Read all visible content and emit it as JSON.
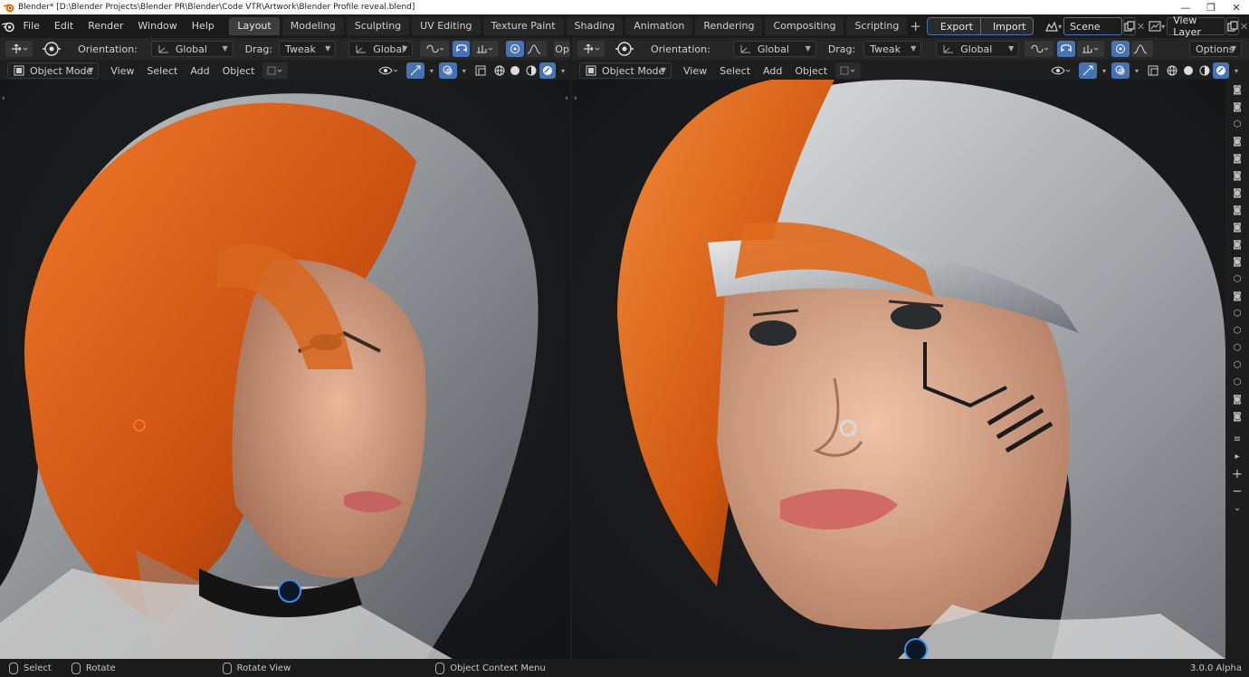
{
  "window": {
    "title": "Blender* [D:\\Blender Projects\\Blender PR\\Blender\\Code VTR\\Artwork\\Blender Profile reveal.blend]"
  },
  "menu": [
    "File",
    "Edit",
    "Render",
    "Window",
    "Help"
  ],
  "workspaces": [
    "Layout",
    "Modeling",
    "Sculpting",
    "UV Editing",
    "Texture Paint",
    "Shading",
    "Animation",
    "Rendering",
    "Compositing",
    "Scripting"
  ],
  "addons": {
    "export_label": "Export",
    "import_label": "Import"
  },
  "scene": {
    "name": "Scene"
  },
  "view_layer": {
    "name": "View Layer"
  },
  "left_viewport": {
    "orientation_label": "Orientation:",
    "orientation_value": "Global",
    "drag_label": "Drag:",
    "drag_value": "Tweak",
    "transform_value": "Global",
    "options_truncated": "Op",
    "mode": "Object Mode",
    "menus": [
      "View",
      "Select",
      "Add",
      "Object"
    ]
  },
  "right_viewport": {
    "orientation_label": "Orientation:",
    "orientation_value": "Global",
    "drag_label": "Drag:",
    "drag_value": "Tweak",
    "transform_value": "Global",
    "options_label": "Options",
    "mode": "Object Mode",
    "menus": [
      "View",
      "Select",
      "Add",
      "Object"
    ]
  },
  "statusbar": {
    "select": "Select",
    "rotate": "Rotate",
    "rotate_view": "Rotate View",
    "context_menu": "Object Context Menu",
    "version": "3.0.0 Alpha"
  },
  "colors": {
    "accent": "#4772b3",
    "hair_orange": "#e0631a",
    "hair_silver": "#b9bcc0",
    "skin": "#d9a88c",
    "background": "#1d1d1d"
  },
  "icons": {
    "tool_strip": [
      "camera-icon",
      "camera-icon",
      "render-region-icon",
      "camera-icon",
      "camera-icon",
      "camera-icon",
      "camera-icon",
      "camera-icon",
      "camera-icon",
      "camera-icon",
      "camera-icon",
      "render-region-icon",
      "camera-icon",
      "render-region-icon",
      "render-region-icon",
      "render-region-icon",
      "render-region-icon",
      "render-region-icon",
      "camera-icon",
      "camera-icon"
    ]
  }
}
